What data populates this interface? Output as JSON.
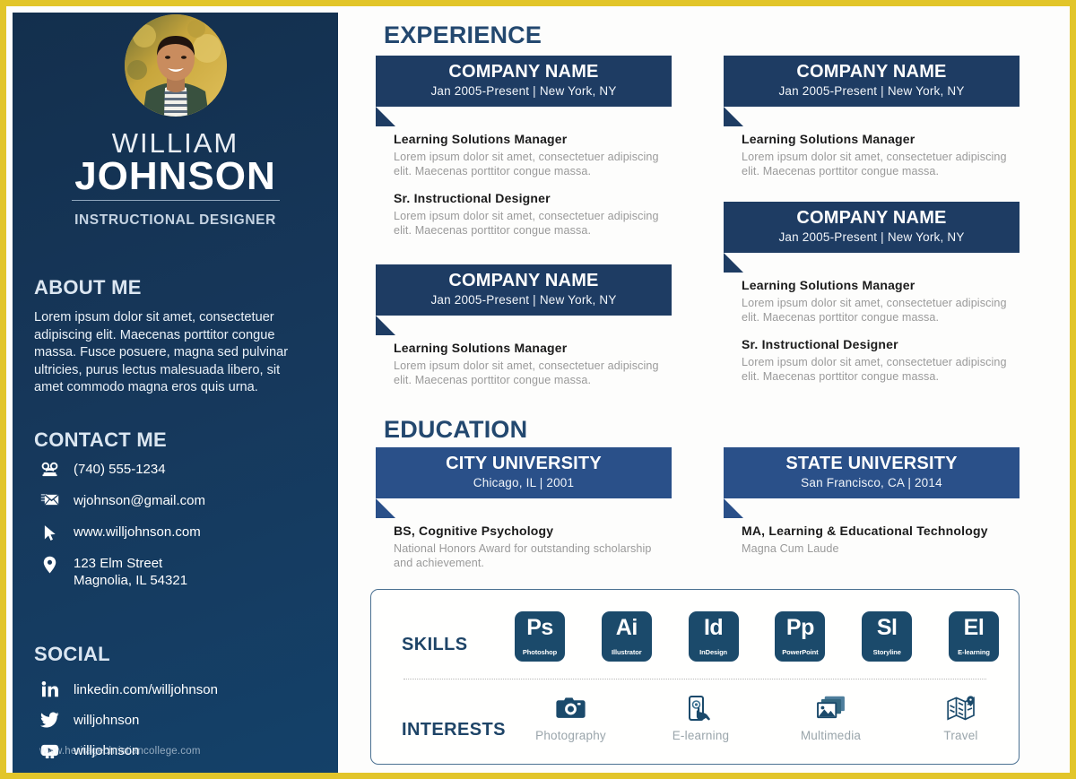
{
  "theme": {
    "gold_border": "#e2c52a",
    "sidebar_navy": "#132f4d",
    "experience_banner": "#1e3c63",
    "education_banner": "#2a5089",
    "section_title": "#23486f",
    "skill_tile": "#1b4a6b",
    "body_gray": "#9a9a9a"
  },
  "sidebar": {
    "name_first": "WILLIAM",
    "name_last": "JOHNSON",
    "job_title": "INSTRUCTIONAL DESIGNER",
    "about_heading": "ABOUT ME",
    "about_text": "Lorem ipsum dolor sit amet, consectetuer adipiscing elit. Maecenas porttitor congue massa. Fusce posuere, magna sed pulvinar ultricies, purus lectus malesuada libero, sit amet commodo magna eros quis urna.",
    "contact_heading": "CONTACT ME",
    "contacts": [
      {
        "icon": "telephone-icon",
        "value": "(740) 555-1234"
      },
      {
        "icon": "envelope-icon",
        "value": "wjohnson@gmail.com"
      },
      {
        "icon": "cursor-arrow-icon",
        "value": "www.willjohnson.com"
      },
      {
        "icon": "map-pin-icon",
        "value": "123 Elm Street\nMagnolia, IL 54321"
      }
    ],
    "social_heading": "SOCIAL",
    "socials": [
      {
        "icon": "linkedin-icon",
        "value": "linkedin.com/willjohnson"
      },
      {
        "icon": "twitter-icon",
        "value": "willjohnson"
      },
      {
        "icon": "youtube-icon",
        "value": "willjohnson"
      }
    ],
    "watermark": "www.heritagechristiancollege.com"
  },
  "experience": {
    "title": "EXPERIENCE",
    "left_column": [
      {
        "company": "COMPANY NAME",
        "meta": "Jan 2005-Present  |  New York, NY",
        "entries": [
          {
            "role": "Learning Solutions  Manager",
            "desc": "Lorem ipsum dolor sit amet, consectetuer adipiscing elit. Maecenas porttitor congue massa."
          },
          {
            "role": "Sr. Instructional  Designer",
            "desc": "Lorem ipsum dolor sit amet, consectetuer adipiscing elit. Maecenas porttitor congue massa."
          }
        ]
      },
      {
        "company": "COMPANY NAME",
        "meta": "Jan 2005-Present  |  New York, NY",
        "entries": [
          {
            "role": "Learning Solutions  Manager",
            "desc": "Lorem ipsum dolor sit amet, consectetuer adipiscing elit. Maecenas porttitor congue massa."
          }
        ]
      }
    ],
    "right_column": [
      {
        "company": "COMPANY NAME",
        "meta": "Jan 2005-Present  |  New York, NY",
        "entries": [
          {
            "role": "Learning Solutions  Manager",
            "desc": "Lorem ipsum dolor sit amet, consectetuer adipiscing elit. Maecenas porttitor congue massa."
          }
        ]
      },
      {
        "company": "COMPANY NAME",
        "meta": "Jan 2005-Present  |  New York, NY",
        "entries": [
          {
            "role": "Learning Solutions  Manager",
            "desc": "Lorem ipsum dolor sit amet, consectetuer adipiscing elit. Maecenas porttitor congue massa."
          },
          {
            "role": "Sr. Instructional  Designer",
            "desc": "Lorem ipsum dolor sit amet, consectetuer adipiscing elit. Maecenas porttitor congue massa."
          }
        ]
      }
    ]
  },
  "education": {
    "title": "EDUCATION",
    "left": {
      "school": "CITY UNIVERSITY",
      "meta": "Chicago, IL  |  2001",
      "degree": "BS, Cognitive Psychology",
      "note": "National  Honors  Award  for  outstanding scholarship  and  achievement."
    },
    "right": {
      "school": "STATE UNIVERSITY",
      "meta": "San Francisco, CA  |  2014",
      "degree": "MA, Learning & Educational  Technology",
      "note": "Magna Cum Laude"
    }
  },
  "panel": {
    "skills_label": "SKILLS",
    "skills": [
      {
        "abbr": "Ps",
        "name": "Photoshop"
      },
      {
        "abbr": "Ai",
        "name": "Illustrator"
      },
      {
        "abbr": "Id",
        "name": "InDesign"
      },
      {
        "abbr": "Pp",
        "name": "PowerPoint"
      },
      {
        "abbr": "Sl",
        "name": "Storyline"
      },
      {
        "abbr": "El",
        "name": "E-learning"
      }
    ],
    "interests_label": "INTERESTS",
    "interests": [
      {
        "icon": "camera-icon",
        "label": "Photography"
      },
      {
        "icon": "mobile-touch-icon",
        "label": "E-learning"
      },
      {
        "icon": "images-stack-icon",
        "label": "Multimedia"
      },
      {
        "icon": "folded-map-icon",
        "label": "Travel"
      }
    ]
  }
}
